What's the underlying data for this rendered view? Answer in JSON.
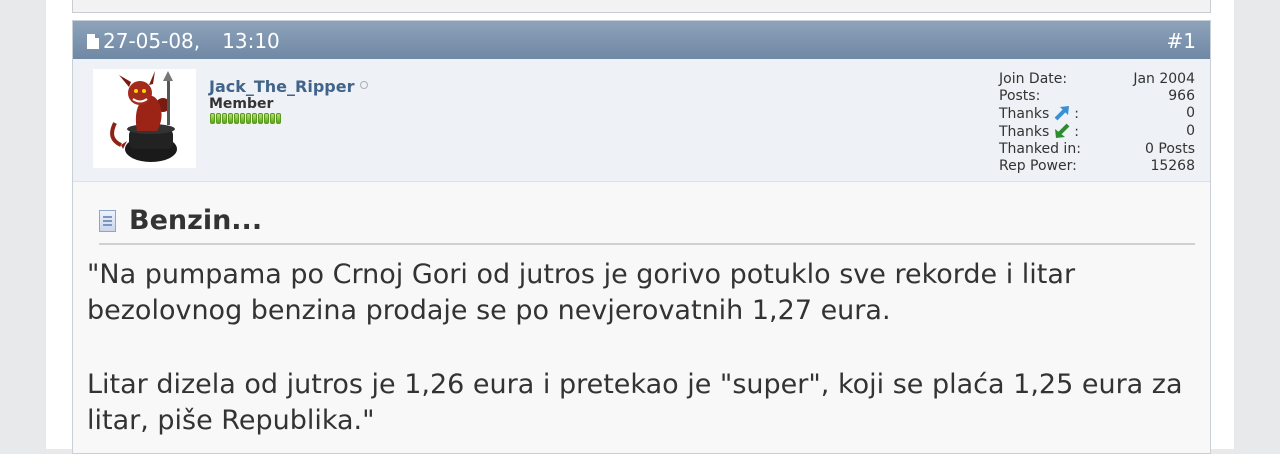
{
  "post": {
    "date": "27-05-08,",
    "time": "13:10",
    "number": "#1"
  },
  "user": {
    "name": "Jack_The_Ripper",
    "title": "Member",
    "reputation_pips": 12,
    "stats": [
      {
        "label": "Join Date:",
        "value": "Jan 2004"
      },
      {
        "label": "Posts:",
        "value": "966"
      },
      {
        "label": "Thanks",
        "icon": "thanks-given-icon",
        "suffix": ":",
        "value": "0"
      },
      {
        "label": "Thanks",
        "icon": "thanks-received-icon",
        "suffix": ":",
        "value": "0"
      },
      {
        "label": "Thanked in:",
        "value": "0 Posts"
      },
      {
        "label": "Rep Power:",
        "value": "15268"
      }
    ]
  },
  "content": {
    "title": "Benzin...",
    "paragraph_1": "\"Na pumpama po Crnoj Gori od jutros je gorivo potuklo sve rekorde i litar bezolovnog benzina prodaje se po nevjerovatnih 1,27 eura.",
    "paragraph_2": "Litar dizela od jutros je 1,26 eura i pretekao je \"super\", koji se plaća 1,25 eura za litar, piše Republika.\""
  },
  "colors": {
    "header_bg": "#7d94ae",
    "username": "#41648b",
    "thanks_given_arrow": "#3b8fd4",
    "thanks_received_arrow": "#2e8b2e"
  }
}
